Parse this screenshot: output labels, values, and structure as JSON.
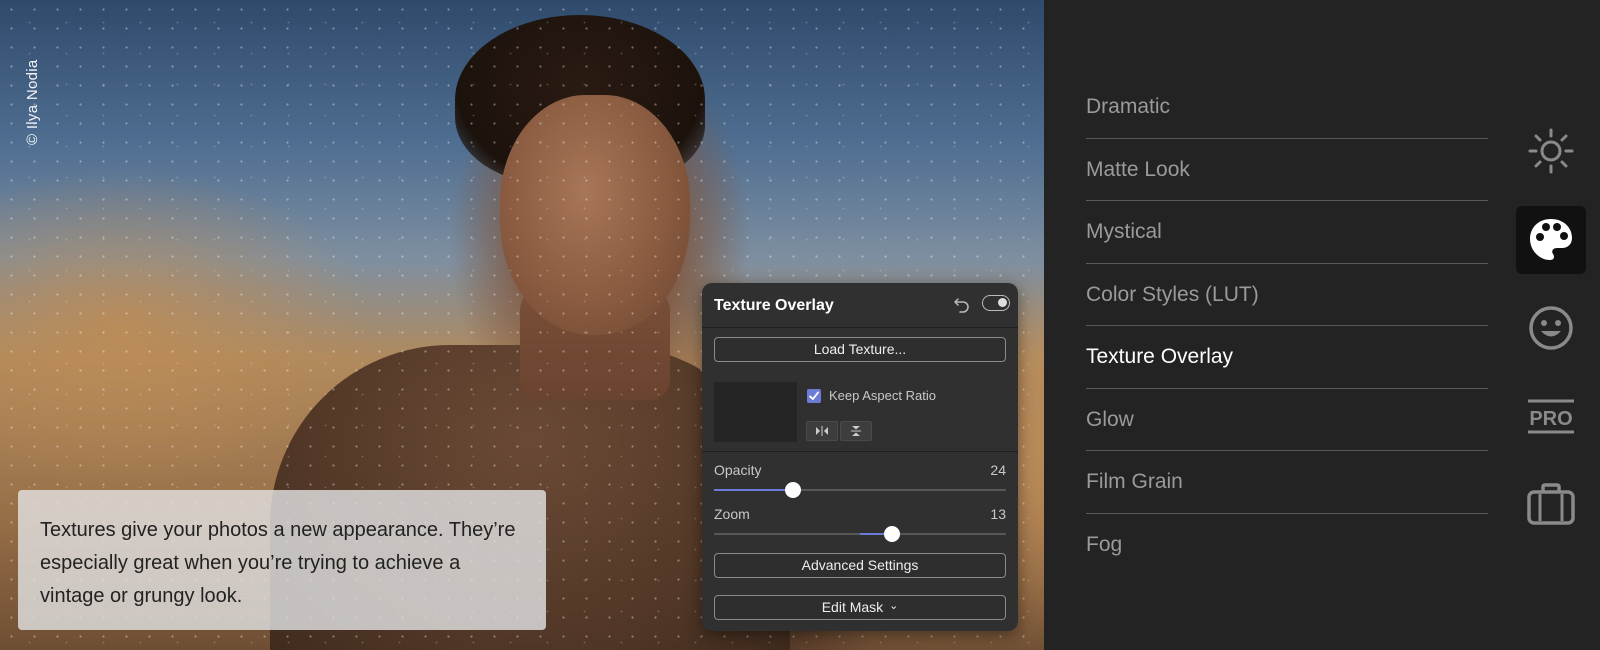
{
  "photo": {
    "credit": "© Ilya Nodia",
    "caption": "Textures give your photos a new appearance. They’re especially great when you’re trying to achieve a vintage or grungy look."
  },
  "texture_panel": {
    "title": "Texture Overlay",
    "load_button": "Load Texture...",
    "keep_aspect_label": "Keep Aspect Ratio",
    "keep_aspect_checked": true,
    "opacity": {
      "label": "Opacity",
      "value": "24",
      "fraction": 0.27
    },
    "zoom": {
      "label": "Zoom",
      "value": "13",
      "fraction": 0.61,
      "fill_from": 0.5
    },
    "advanced_button": "Advanced Settings",
    "mask_button": "Edit Mask",
    "mask_chevron": "⌄"
  },
  "sidebar": {
    "items": [
      {
        "label": "Dramatic",
        "active": false
      },
      {
        "label": "Matte Look",
        "active": false
      },
      {
        "label": "Mystical",
        "active": false
      },
      {
        "label": "Color Styles (LUT)",
        "active": false
      },
      {
        "label": "Texture Overlay",
        "active": true
      },
      {
        "label": "Glow",
        "active": false
      },
      {
        "label": "Film Grain",
        "active": false
      },
      {
        "label": "Fog",
        "active": false
      }
    ],
    "tools": [
      {
        "icon": "sun-icon",
        "active": false
      },
      {
        "icon": "palette-icon",
        "active": true
      },
      {
        "icon": "face-icon",
        "active": false
      },
      {
        "icon": "pro-icon",
        "label": "PRO",
        "active": false
      },
      {
        "icon": "briefcase-icon",
        "active": false
      }
    ]
  },
  "colors": {
    "accent": "#6b7bd6",
    "sidebar_bg": "#232323",
    "panel_bg": "#303030",
    "active_text": "#ffffff",
    "inactive_text": "#9a9a9a"
  }
}
